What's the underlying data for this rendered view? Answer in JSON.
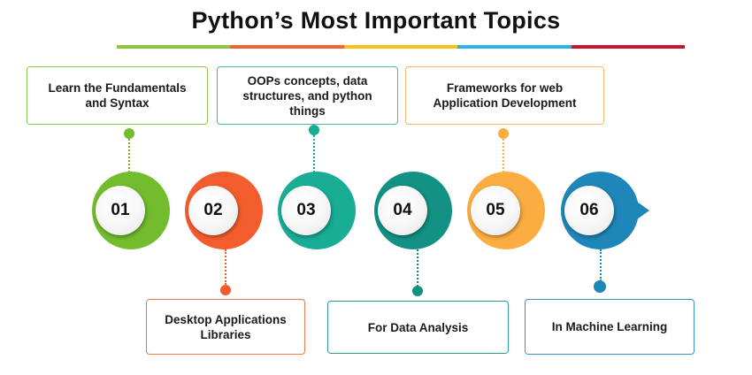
{
  "title": "Python’s Most Important Topics",
  "title_bar_colors": [
    "#8cc63f",
    "#f26430",
    "#f9c21b",
    "#29b3e6",
    "#c5162e"
  ],
  "steps": [
    {
      "number": "01",
      "label": "Learn the Fundamentals and Syntax",
      "color": "#72bc2e",
      "position": "top"
    },
    {
      "number": "02",
      "label": "Desktop Applications Libraries",
      "color": "#f35d2e",
      "position": "bottom"
    },
    {
      "number": "03",
      "label": "OOPs concepts, data structures, and python things",
      "color": "#19ad96",
      "position": "top"
    },
    {
      "number": "04",
      "label": "For Data Analysis",
      "color": "#139184",
      "position": "bottom"
    },
    {
      "number": "05",
      "label": "Frameworks for web Application Development",
      "color": "#fbad41",
      "position": "top"
    },
    {
      "number": "06",
      "label": "In Machine Learning",
      "color": "#1f86b9",
      "position": "bottom"
    }
  ],
  "box_border_colors": [
    "#8ccc4b",
    "#f07a4c",
    "#4bb9ac",
    "#2e9d93",
    "#f5b863",
    "#3d93c6"
  ],
  "icons": {
    "final_step_tip": "arrow-tip-right"
  }
}
